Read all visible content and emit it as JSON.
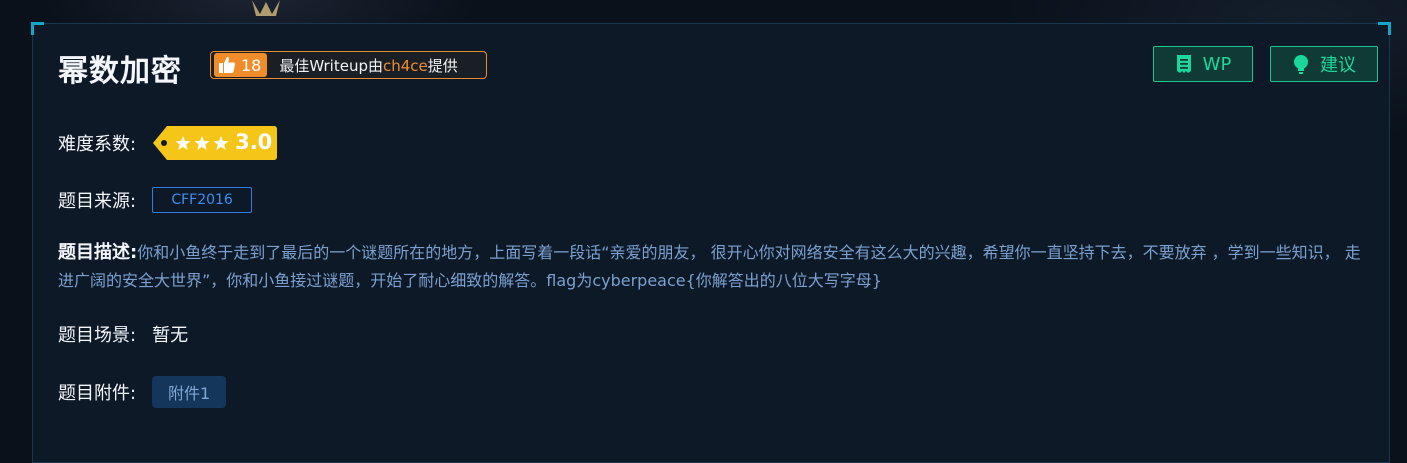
{
  "challenge": {
    "title": "幂数加密",
    "likes": "18",
    "writeup_prefix": "最佳Writeup由",
    "writeup_author": "ch4ce",
    "writeup_suffix": "提供"
  },
  "actions": {
    "wp_label": "WP",
    "suggest_label": "建议"
  },
  "difficulty": {
    "label": "难度系数:",
    "stars": 3,
    "score": "3.0"
  },
  "source": {
    "label": "题目来源:",
    "value": "CFF2016"
  },
  "description": {
    "label": "题目描述:",
    "text": "你和小鱼终于走到了最后的一个谜题所在的地方，上面写着一段话“亲爱的朋友， 很开心你对网络安全有这么大的兴趣，希望你一直坚持下去，不要放弃 ，学到一些知识， 走进广阔的安全大世界”，你和小鱼接过谜题，开始了耐心细致的解答。flag为cyberpeace{你解答出的八位大写字母}"
  },
  "scene": {
    "label": "题目场景:",
    "value": "暂无"
  },
  "attachment": {
    "label": "题目附件:",
    "file_label": "附件1"
  },
  "colors": {
    "accent_orange": "#f08d2a",
    "accent_green": "#19d89a",
    "accent_blue": "#2f7fe0",
    "difficulty_yellow": "#f5c518"
  }
}
